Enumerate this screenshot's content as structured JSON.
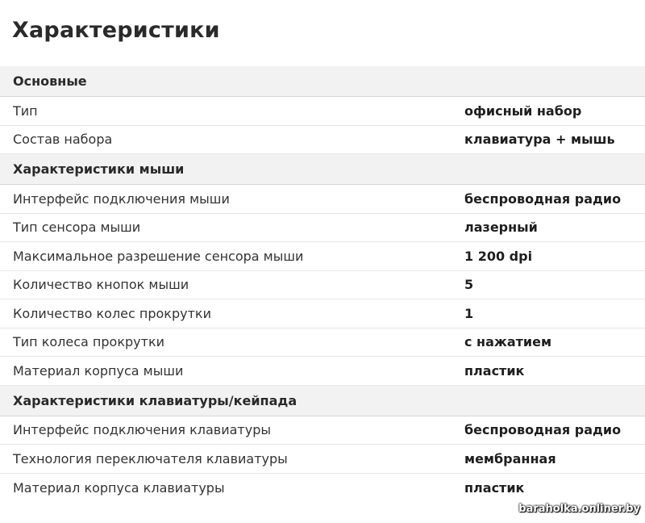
{
  "title": "Характеристики",
  "sections": [
    {
      "header": "Основные",
      "rows": [
        {
          "label": "Тип",
          "value": "офисный набор"
        },
        {
          "label": "Состав набора",
          "value": "клавиатура + мышь"
        }
      ]
    },
    {
      "header": "Характеристики мыши",
      "rows": [
        {
          "label": "Интерфейс подключения мыши",
          "value": "беспроводная радио"
        },
        {
          "label": "Тип сенсора мыши",
          "value": "лазерный"
        },
        {
          "label": "Максимальное разрешение сенсора мыши",
          "value": "1 200 dpi"
        },
        {
          "label": "Количество кнопок мыши",
          "value": "5"
        },
        {
          "label": "Количество колес прокрутки",
          "value": "1"
        },
        {
          "label": "Тип колеса прокрутки",
          "value": "с нажатием"
        },
        {
          "label": "Материал корпуса мыши",
          "value": "пластик"
        }
      ]
    },
    {
      "header": "Характеристики клавиатуры/кейпада",
      "rows": [
        {
          "label": "Интерфейс подключения клавиатуры",
          "value": "беспроводная радио"
        },
        {
          "label": "Технология переключателя клавиатуры",
          "value": "мембранная"
        },
        {
          "label": "Материал корпуса клавиатуры",
          "value": "пластик"
        }
      ]
    }
  ],
  "watermark": "baraholka.onliner.by"
}
